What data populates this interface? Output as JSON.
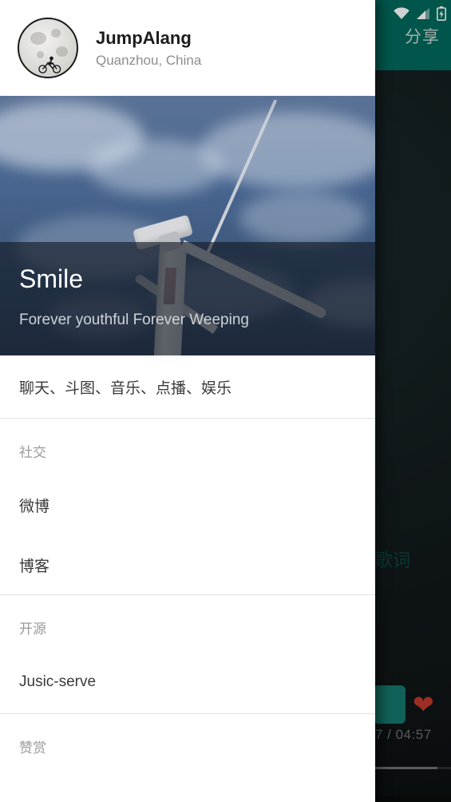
{
  "background_app": {
    "appbar_title": "分享",
    "status_icons": [
      "wifi-icon",
      "signal-icon",
      "battery-charging-icon"
    ],
    "lyric_text": "歌词",
    "time_label": "7 / 04:57",
    "heart_icon": "heart-icon",
    "action_button": "action-button"
  },
  "drawer": {
    "header": {
      "name": "JumpAlang",
      "location": "Quanzhou, China",
      "avatar_icon": "moon-cyclist-avatar"
    },
    "banner": {
      "title": "Smile",
      "subtitle": "Forever youthful Forever Weeping",
      "image_alt": "wind-turbine-sky"
    },
    "top_item": {
      "label": "聊天、斗图、音乐、点播、娱乐"
    },
    "sections": [
      {
        "header": "社交",
        "items": [
          {
            "label": "微博"
          },
          {
            "label": "博客"
          }
        ]
      },
      {
        "header": "开源",
        "items": [
          {
            "label": "Jusic-serve"
          }
        ]
      },
      {
        "header": "赞赏",
        "items": []
      }
    ]
  },
  "colors": {
    "appbar_teal": "#00695c",
    "accent_teal": "#14776c",
    "heart_red": "#c0392b",
    "drawer_bg": "#ffffff",
    "divider": "#e2e2e2"
  }
}
